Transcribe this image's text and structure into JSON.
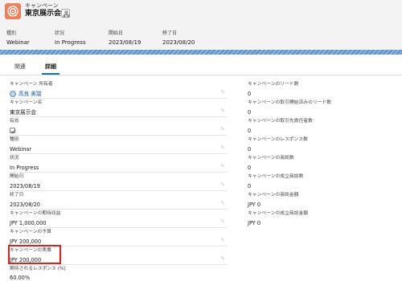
{
  "header": {
    "subtitle": "キャンペーン",
    "title": "東京展示会",
    "highlights": [
      {
        "label": "種別",
        "value": "Webinar"
      },
      {
        "label": "状況",
        "value": "In Progress"
      },
      {
        "label": "開始日",
        "value": "2023/08/19"
      },
      {
        "label": "終了日",
        "value": "2023/08/20"
      }
    ]
  },
  "tabs": [
    {
      "label": "関連"
    },
    {
      "label": "詳細"
    }
  ],
  "left_fields": [
    {
      "label": "キャンペーン 所有者",
      "value": "高良 美瑞"
    },
    {
      "label": "キャンペーン名",
      "value": "東京展示会"
    },
    {
      "label": "有効",
      "value": ""
    },
    {
      "label": "種別",
      "value": "Webinar"
    },
    {
      "label": "状況",
      "value": "In Progress"
    },
    {
      "label": "開始日",
      "value": "2023/08/19"
    },
    {
      "label": "終了日",
      "value": "2023/08/20"
    },
    {
      "label": "キャンペーンの期待収益",
      "value": "JPY 1,000,000"
    },
    {
      "label": "キャンペーンの予算",
      "value": "JPY 200,000"
    },
    {
      "label": "キャンペーンの実費",
      "value": "JPY 200,000"
    },
    {
      "label": "期待されるレスポンス (%)",
      "value": "60.00%"
    }
  ],
  "right_fields": [
    {
      "label": "キャンペーンのリード数",
      "value": "0"
    },
    {
      "label": "キャンペーンの取引開始済みのリード数",
      "value": "0"
    },
    {
      "label": "キャンペーンの取引先責任者数",
      "value": "0"
    },
    {
      "label": "キャンペーンのレスポンス数",
      "value": "0"
    },
    {
      "label": "キャンペーンの商談数",
      "value": "0"
    },
    {
      "label": "キャンペーンの成立商談数",
      "value": "0"
    },
    {
      "label": "キャンペーンの商談金額",
      "value": "JPY 0"
    },
    {
      "label": "キャンペーンの成立商談金額",
      "value": "JPY 0"
    }
  ],
  "icons": {
    "app": "campaign-icon",
    "hierarchy": "hierarchy-icon",
    "edit": "pencil-icon",
    "owner": "user-avatar-icon",
    "active_checkbox": "checkbox-checked-icon"
  },
  "colors": {
    "app_icon": "#f07e56",
    "link": "#0b5cab",
    "tab_active": "#0176d3",
    "highlight_box": "#d9251d"
  }
}
